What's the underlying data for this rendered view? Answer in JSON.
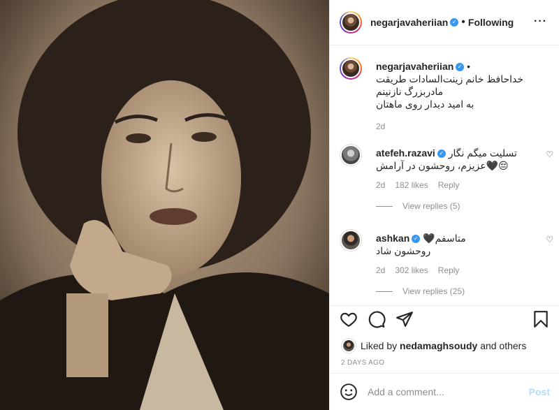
{
  "post": {
    "photo_alt_icon": "portrait-photo",
    "author": "negarjavaheriian",
    "follow_status": "Following",
    "more_icon": "more-options-icon"
  },
  "caption": {
    "author": "negarjavaheriian",
    "lines": [
      "خداحافظ خانم زینت‌السادات طریقت",
      "مادربزرگ نازنینم",
      "به امید دیدار روی ماهتان"
    ],
    "time": "2d"
  },
  "comments": [
    {
      "user": "atefeh.razavi",
      "text1": "تسلیت میگم نگار",
      "text2": "😔🖤عزیزم، روحشون در آرامش",
      "time": "2d",
      "likes": "182 likes",
      "reply": "Reply",
      "view_replies": "View replies (5)"
    },
    {
      "user": "ashkan",
      "text1": "متاسفم🖤",
      "text2": "روحشون شاد",
      "time": "2d",
      "likes": "302 likes",
      "reply": "Reply",
      "view_replies": "View replies (25)"
    }
  ],
  "liked_by": {
    "prefix": "Liked by",
    "user": "nedamaghsoudy",
    "suffix": "and others"
  },
  "time_ago": "2 DAYS AGO",
  "add_comment": {
    "placeholder": "Add a comment...",
    "post_label": "Post"
  },
  "colors": {
    "verified": "#3897f0",
    "muted": "#8e8e8e",
    "post_disabled": "#b2dffc"
  }
}
